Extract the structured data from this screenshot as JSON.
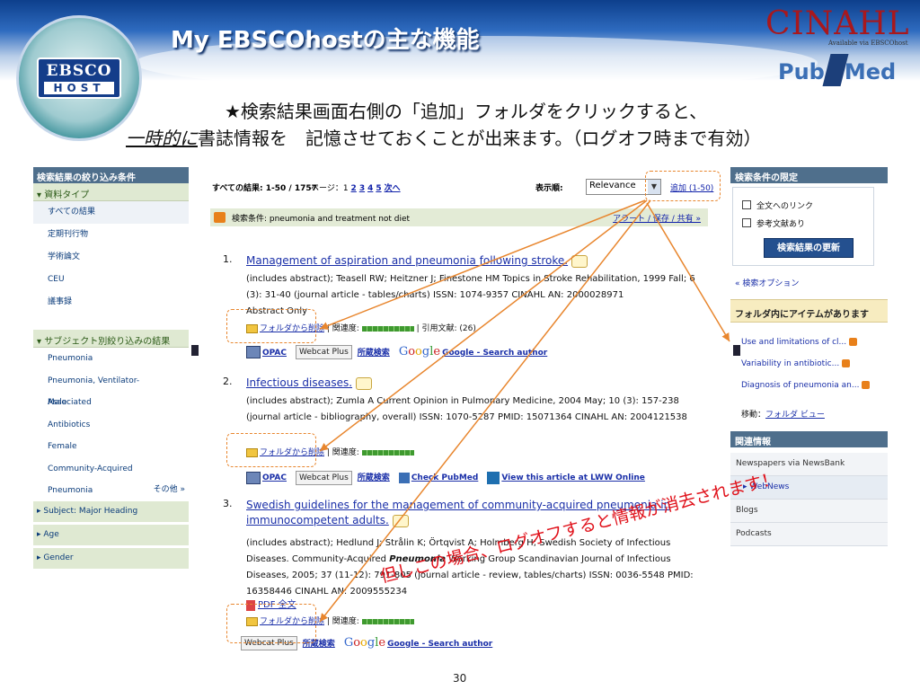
{
  "slide": {
    "title": "My EBSCOhostの主な機能",
    "logo_top": "EBSCO",
    "logo_bottom": "HOST",
    "cinahl": "CINAHL",
    "cinahl_sub": "Available via EBSCOhost",
    "pubmed_a": "Pub",
    "pubmed_b": "Med",
    "note_line1": "★検索結果画面右側の「追加」フォルダをクリックすると、",
    "note_line2_em": "一時的に",
    "note_line2_rest": "書誌情報を　記憶させておくことが出来ます。（ログオフ時まで有効）",
    "warning": "但しこの場合、ログオフすると情報が消去されます！",
    "page_number": "30"
  },
  "left_panel": {
    "header": "検索結果の絞り込み条件",
    "source_type_header": "資料タイプ",
    "source_types": [
      "すべての結果",
      "定期刊行物",
      "学術論文",
      "CEU",
      "議事録"
    ],
    "subject_header": "サブジェクト別絞り込みの結果",
    "subjects": [
      "Pneumonia",
      "Pneumonia, Ventilator-Associated",
      "Male",
      "Antibiotics",
      "Female",
      "Community-Acquired Pneumonia"
    ],
    "more": "その他 »",
    "sections": [
      "Subject: Major Heading",
      "Age",
      "Gender"
    ]
  },
  "toolbar": {
    "count": "すべての結果: 1-50 / 1757",
    "pages_label": "ページ：1",
    "pages": [
      "2",
      "3",
      "4",
      "5",
      "次へ"
    ],
    "sort_label": "表示順:",
    "sort_value": "Relevance",
    "add_link": "追加 (1-50)"
  },
  "query": {
    "label": "検索条件: pneumonia and treatment not diet",
    "alert": "アラート / 保存 / 共有 »"
  },
  "results": [
    {
      "num": "1.",
      "title": "Management of aspiration and pneumonia following stroke.",
      "body": "(includes abstract); Teasell RW; Heitzner J; Finestone HM Topics in Stroke Rehabilitation, 1999 Fall; 6 (3): 31-40 (journal article - tables/charts) ISSN: 1074-9357 CINAHL AN: 2000028971",
      "extra": "Abstract Only",
      "remove": "フォルダから削除",
      "relevance": "関連度:",
      "cited": "引用文献: (26)",
      "tools": [
        "OPAC",
        "Webcat Plus",
        "所蔵検索",
        "Google - Search author"
      ]
    },
    {
      "num": "2.",
      "title": "Infectious diseases.",
      "body": "(includes abstract); Zumla A Current Opinion in Pulmonary Medicine, 2004 May; 10 (3): 157-238 (journal article - bibliography, overall) ISSN: 1070-5287 PMID: 15071364 CINAHL AN: 2004121538",
      "remove": "フォルダから削除",
      "relevance": "関連度:",
      "tools": [
        "OPAC",
        "Webcat Plus",
        "所蔵検索",
        "Check PubMed",
        "View this article at LWW Online"
      ]
    },
    {
      "num": "3.",
      "title_line1": "Swedish guidelines for the management of community-acquired pneumonia in",
      "title_line2": "immunocompetent adults.",
      "body_a": "(includes abstract); Hedlund J; Strålin K; Örtqvist A; Holmberg H; Swedish Society of Infectious Diseases. Community-Acquired ",
      "body_em": "Pneumonia",
      "body_b": " Working Group Scandinavian Journal of Infectious Diseases, 2005; 37 (11-12): 791-805 (journal article - review, tables/charts) ISSN: 0036-5548 PMID: 16358446 CINAHL AN: 2009555234",
      "pdf": "PDF 全文",
      "remove": "フォルダから削除",
      "relevance": "関連度:",
      "tools": [
        "Webcat Plus",
        "所蔵検索",
        "Google - Search author"
      ]
    }
  ],
  "right_panel": {
    "header": "検索条件の限定",
    "fulltext": "全文へのリンク",
    "references": "参考文献あり",
    "update": "検索結果の更新",
    "options": "« 検索オプション",
    "folder_header": "フォルダ内にアイテムがあります",
    "folder_items": [
      "Use and limitations of cl...",
      "Variability in antibiotic...",
      "Diagnosis of pneumonia an..."
    ],
    "move_label": "移動：",
    "move_link": "フォルダ ビュー",
    "related_header": "関連情報",
    "related": [
      "Newspapers via NewsBank",
      "WebNews",
      "Blogs",
      "Podcasts"
    ]
  }
}
